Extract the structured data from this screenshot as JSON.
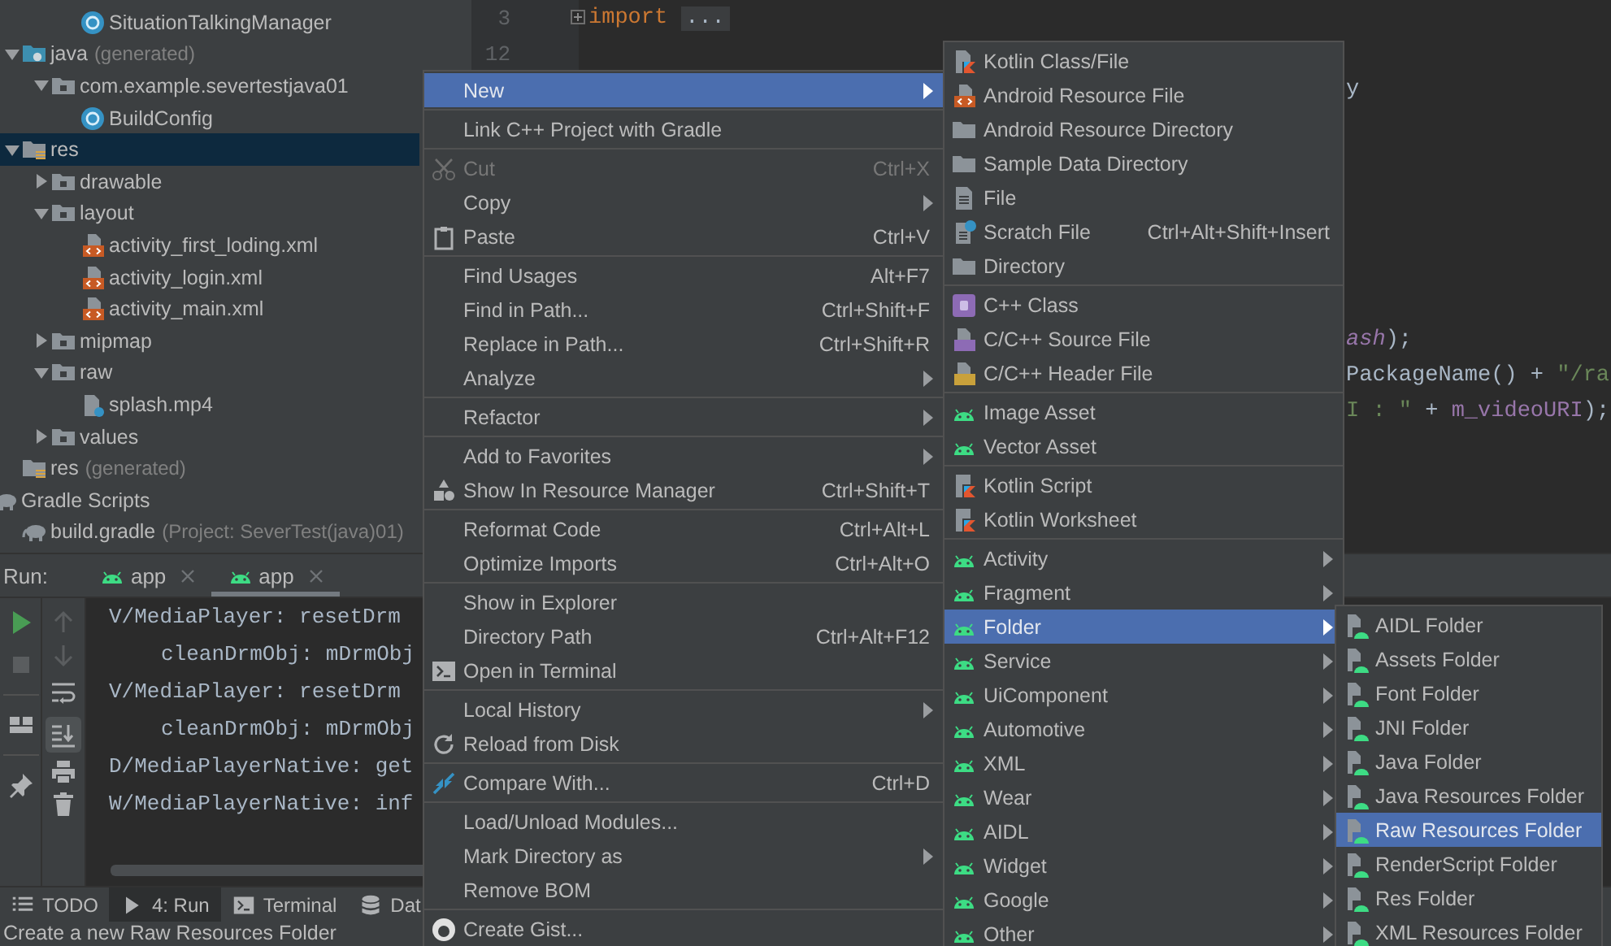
{
  "project_tree": {
    "partial_item": {
      "label": "SituationTalkingManager",
      "kind": "class"
    },
    "items": [
      {
        "label": "java",
        "note": "(generated)",
        "kind": "java-folder",
        "expanded": true,
        "selected": false,
        "children": [
          {
            "label": "com.example.severtestjava01",
            "kind": "package",
            "expanded": true,
            "selected": false,
            "children": [
              {
                "label": "BuildConfig",
                "kind": "class",
                "selected": false
              }
            ]
          }
        ]
      },
      {
        "label": "res",
        "kind": "res-folder",
        "expanded": true,
        "selected": true,
        "children": [
          {
            "label": "drawable",
            "kind": "package",
            "expanded": false,
            "selected": false
          },
          {
            "label": "layout",
            "kind": "package",
            "expanded": true,
            "selected": false,
            "children": [
              {
                "label": "activity_first_loding.xml",
                "kind": "xml",
                "selected": false
              },
              {
                "label": "activity_login.xml",
                "kind": "xml",
                "selected": false
              },
              {
                "label": "activity_main.xml",
                "kind": "xml",
                "selected": false
              }
            ]
          },
          {
            "label": "mipmap",
            "kind": "package",
            "expanded": false,
            "selected": false
          },
          {
            "label": "raw",
            "kind": "package",
            "expanded": true,
            "selected": false,
            "children": [
              {
                "label": "splash.mp4",
                "kind": "media",
                "selected": false
              }
            ]
          },
          {
            "label": "values",
            "kind": "package",
            "expanded": false,
            "selected": false
          }
        ]
      },
      {
        "label": "res",
        "note": "(generated)",
        "kind": "res-folder",
        "selected": false
      }
    ],
    "gradle_scripts": {
      "label": "Gradle Scripts",
      "kind": "gradle",
      "selected": false,
      "children": [
        {
          "label": "build.gradle",
          "note": "(Project: SeverTest(java)01)",
          "kind": "gradle",
          "selected": false
        }
      ]
    }
  },
  "editor": {
    "lines": [
      {
        "kind": "code",
        "number": "3",
        "folded": true,
        "segments": [
          {
            "kind": "keyword",
            "text": "import"
          },
          {
            "kind": "folded",
            "text": "..."
          }
        ]
      },
      {
        "kind": "code",
        "number": "12"
      },
      {
        "kind": "tail",
        "segments": [
          {
            "kind": "plain",
            "text": "y"
          }
        ]
      },
      {
        "kind": "blank"
      },
      {
        "kind": "blank"
      },
      {
        "kind": "blank"
      },
      {
        "kind": "blank"
      },
      {
        "kind": "blank"
      },
      {
        "kind": "blank"
      },
      {
        "kind": "tail",
        "segments": [
          {
            "kind": "static",
            "text": "ash"
          },
          {
            "kind": "plain",
            "text": ");"
          }
        ]
      },
      {
        "kind": "tail",
        "segments": [
          {
            "kind": "plain",
            "text": "PackageName() + "
          },
          {
            "kind": "string",
            "text": "\"/ra"
          }
        ]
      },
      {
        "kind": "tail",
        "segments": [
          {
            "kind": "string",
            "text": "I : \""
          },
          {
            "kind": "plain",
            "text": " + "
          },
          {
            "kind": "field",
            "text": "m_videoURI"
          },
          {
            "kind": "plain",
            "text": ");"
          }
        ]
      }
    ]
  },
  "run_panel": {
    "label": "Run:",
    "tabs": [
      {
        "label": "app",
        "selected": false
      },
      {
        "label": "app",
        "selected": true
      }
    ],
    "toggles": {
      "soft_wrap": false,
      "scroll_to_end": true
    },
    "log": [
      {
        "kind": "entry",
        "text": "V/MediaPlayer: resetDrm"
      },
      {
        "kind": "continuation",
        "text": "cleanDrmObj: mDrmObj"
      },
      {
        "kind": "entry",
        "text": "V/MediaPlayer: resetDrm"
      },
      {
        "kind": "continuation",
        "text": "cleanDrmObj: mDrmObj"
      },
      {
        "kind": "entry",
        "text": "D/MediaPlayerNative: get"
      },
      {
        "kind": "entry",
        "text": "W/MediaPlayerNative: inf"
      }
    ]
  },
  "bottom_tabs": [
    {
      "label": "TODO",
      "kind": "list",
      "selected": false
    },
    {
      "label": "4: Run",
      "kind": "play",
      "selected": true
    },
    {
      "label": "Terminal",
      "kind": "terminal",
      "selected": false
    },
    {
      "label": "Dat",
      "kind": "database",
      "selected": false
    }
  ],
  "status_bar": {
    "text": "Create a new Raw Resources Folder"
  },
  "context_menu": {
    "sections": [
      [
        {
          "label": "New",
          "kind": "plain",
          "submenu": true,
          "disabled": false,
          "selected": true
        }
      ],
      [
        {
          "label": "Link C++ Project with Gradle",
          "kind": "plain",
          "submenu": false,
          "disabled": false,
          "selected": false
        }
      ],
      [
        {
          "label": "Cut",
          "shortcut": "Ctrl+X",
          "kind": "scissors",
          "submenu": false,
          "disabled": true,
          "selected": false
        },
        {
          "label": "Copy",
          "kind": "plain",
          "submenu": true,
          "disabled": false,
          "selected": false
        },
        {
          "label": "Paste",
          "shortcut": "Ctrl+V",
          "kind": "clipboard",
          "submenu": false,
          "disabled": false,
          "selected": false
        }
      ],
      [
        {
          "label": "Find Usages",
          "shortcut": "Alt+F7",
          "kind": "plain",
          "submenu": false,
          "disabled": false,
          "selected": false
        },
        {
          "label": "Find in Path...",
          "shortcut": "Ctrl+Shift+F",
          "kind": "plain",
          "submenu": false,
          "disabled": false,
          "selected": false
        },
        {
          "label": "Replace in Path...",
          "shortcut": "Ctrl+Shift+R",
          "kind": "plain",
          "submenu": false,
          "disabled": false,
          "selected": false
        },
        {
          "label": "Analyze",
          "kind": "plain",
          "submenu": true,
          "disabled": false,
          "selected": false
        }
      ],
      [
        {
          "label": "Refactor",
          "kind": "plain",
          "submenu": true,
          "disabled": false,
          "selected": false
        }
      ],
      [
        {
          "label": "Add to Favorites",
          "kind": "plain",
          "submenu": true,
          "disabled": false,
          "selected": false
        },
        {
          "label": "Show In Resource Manager",
          "shortcut": "Ctrl+Shift+T",
          "kind": "shapes",
          "submenu": false,
          "disabled": false,
          "selected": false
        }
      ],
      [
        {
          "label": "Reformat Code",
          "shortcut": "Ctrl+Alt+L",
          "kind": "plain",
          "submenu": false,
          "disabled": false,
          "selected": false
        },
        {
          "label": "Optimize Imports",
          "shortcut": "Ctrl+Alt+O",
          "kind": "plain",
          "submenu": false,
          "disabled": false,
          "selected": false
        }
      ],
      [
        {
          "label": "Show in Explorer",
          "kind": "plain",
          "submenu": false,
          "disabled": false,
          "selected": false
        },
        {
          "label": "Directory Path",
          "shortcut": "Ctrl+Alt+F12",
          "kind": "plain",
          "submenu": false,
          "disabled": false,
          "selected": false
        },
        {
          "label": "Open in Terminal",
          "kind": "terminal",
          "submenu": false,
          "disabled": false,
          "selected": false
        }
      ],
      [
        {
          "label": "Local History",
          "kind": "plain",
          "submenu": true,
          "disabled": false,
          "selected": false
        },
        {
          "label": "Reload from Disk",
          "kind": "reload",
          "submenu": false,
          "disabled": false,
          "selected": false
        }
      ],
      [
        {
          "label": "Compare With...",
          "shortcut": "Ctrl+D",
          "kind": "compare",
          "submenu": false,
          "disabled": false,
          "selected": false
        }
      ],
      [
        {
          "label": "Load/Unload Modules...",
          "kind": "plain",
          "submenu": false,
          "disabled": false,
          "selected": false
        },
        {
          "label": "Mark Directory as",
          "kind": "plain",
          "submenu": true,
          "disabled": false,
          "selected": false
        },
        {
          "label": "Remove BOM",
          "kind": "plain",
          "submenu": false,
          "disabled": false,
          "selected": false
        }
      ],
      [
        {
          "label": "Create Gist...",
          "kind": "gist",
          "submenu": false,
          "disabled": false,
          "selected": false
        }
      ]
    ]
  },
  "new_submenu": {
    "sections": [
      [
        {
          "label": "Kotlin Class/File",
          "kind": "kotlin",
          "submenu": false,
          "selected": false
        },
        {
          "label": "Android Resource File",
          "kind": "xml",
          "submenu": false,
          "selected": false
        },
        {
          "label": "Android Resource Directory",
          "kind": "folder",
          "submenu": false,
          "selected": false
        },
        {
          "label": "Sample Data Directory",
          "kind": "folder",
          "submenu": false,
          "selected": false
        },
        {
          "label": "File",
          "kind": "file",
          "submenu": false,
          "selected": false
        },
        {
          "label": "Scratch File",
          "shortcut": "Ctrl+Alt+Shift+Insert",
          "kind": "scratch",
          "submenu": false,
          "selected": false
        },
        {
          "label": "Directory",
          "kind": "folder",
          "submenu": false,
          "selected": false
        }
      ],
      [
        {
          "label": "C++ Class",
          "kind": "cpp-class",
          "submenu": false,
          "selected": false
        },
        {
          "label": "C/C++ Source File",
          "kind": "cpp-source",
          "submenu": false,
          "selected": false
        },
        {
          "label": "C/C++ Header File",
          "kind": "cpp-header",
          "submenu": false,
          "selected": false
        }
      ],
      [
        {
          "label": "Image Asset",
          "kind": "robot",
          "submenu": false,
          "selected": false
        },
        {
          "label": "Vector Asset",
          "kind": "robot",
          "submenu": false,
          "selected": false
        }
      ],
      [
        {
          "label": "Kotlin Script",
          "kind": "kotlin-script",
          "submenu": false,
          "selected": false
        },
        {
          "label": "Kotlin Worksheet",
          "kind": "kotlin-script",
          "submenu": false,
          "selected": false
        }
      ],
      [
        {
          "label": "Activity",
          "kind": "robot",
          "submenu": true,
          "selected": false
        },
        {
          "label": "Fragment",
          "kind": "robot",
          "submenu": true,
          "selected": false
        },
        {
          "label": "Folder",
          "kind": "robot",
          "submenu": true,
          "selected": true
        },
        {
          "label": "Service",
          "kind": "robot",
          "submenu": true,
          "selected": false
        },
        {
          "label": "UiComponent",
          "kind": "robot",
          "submenu": true,
          "selected": false
        },
        {
          "label": "Automotive",
          "kind": "robot",
          "submenu": true,
          "selected": false
        },
        {
          "label": "XML",
          "kind": "robot",
          "submenu": true,
          "selected": false
        },
        {
          "label": "Wear",
          "kind": "robot",
          "submenu": true,
          "selected": false
        },
        {
          "label": "AIDL",
          "kind": "robot",
          "submenu": true,
          "selected": false
        },
        {
          "label": "Widget",
          "kind": "robot",
          "submenu": true,
          "selected": false
        },
        {
          "label": "Google",
          "kind": "robot",
          "submenu": true,
          "selected": false
        },
        {
          "label": "Other",
          "kind": "robot",
          "submenu": true,
          "selected": false
        }
      ]
    ]
  },
  "folder_submenu": {
    "sections": [
      [
        {
          "label": "AIDL Folder",
          "kind": "robot-file",
          "selected": false
        },
        {
          "label": "Assets Folder",
          "kind": "robot-file",
          "selected": false
        },
        {
          "label": "Font Folder",
          "kind": "robot-file",
          "selected": false
        },
        {
          "label": "JNI Folder",
          "kind": "robot-file",
          "selected": false
        },
        {
          "label": "Java Folder",
          "kind": "robot-file",
          "selected": false
        },
        {
          "label": "Java Resources Folder",
          "kind": "robot-file",
          "selected": false
        },
        {
          "label": "Raw Resources Folder",
          "kind": "robot-file",
          "selected": true
        },
        {
          "label": "RenderScript Folder",
          "kind": "robot-file",
          "selected": false
        },
        {
          "label": "Res Folder",
          "kind": "robot-file",
          "selected": false
        },
        {
          "label": "XML Resources Folder",
          "kind": "robot-file",
          "selected": false
        }
      ]
    ]
  }
}
